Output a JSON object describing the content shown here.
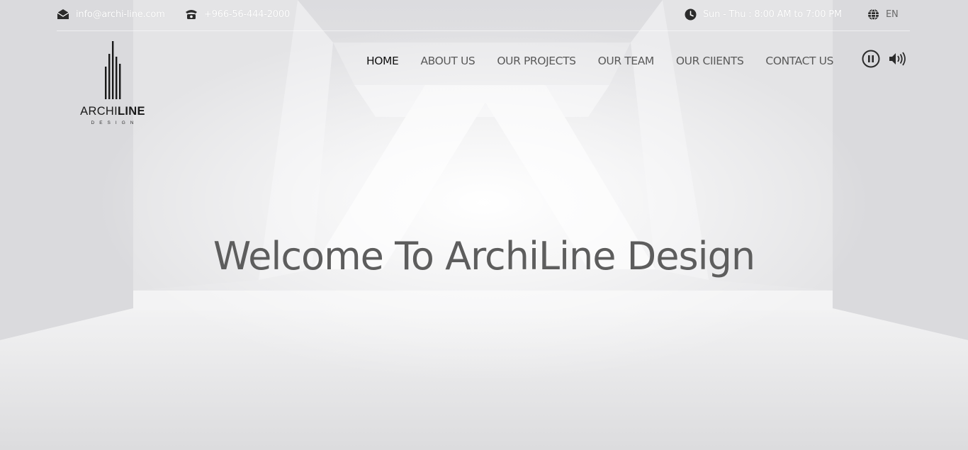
{
  "topbar": {
    "email": "info@archi-line.com",
    "phone": "+966-56-444-2000",
    "hours": "Sun - Thu : 8:00 AM to 7:00 PM",
    "language": "EN"
  },
  "logo": {
    "word_light": "ARCHI",
    "word_bold": "LINE",
    "subtitle": "DESIGN"
  },
  "nav": {
    "items": [
      {
        "label": "HOME",
        "active": true
      },
      {
        "label": "ABOUT US"
      },
      {
        "label": "OUR PROJECTS"
      },
      {
        "label": "OUR TEAM"
      },
      {
        "label": "OUR CIIENTS"
      },
      {
        "label": "CONTACT US"
      }
    ]
  },
  "media": {
    "pause_icon": "pause-circle-icon",
    "volume_icon": "volume-icon"
  },
  "hero": {
    "headline": "Welcome To ArchiLine Design"
  },
  "icons": {
    "email": "envelope-icon",
    "phone": "telephone-icon",
    "hours": "clock-icon",
    "language": "globe-icon"
  },
  "colors": {
    "nav_text": "#5a5a5a",
    "nav_active": "#111111",
    "topbar_text": "#ffffff",
    "hero_text": "#5d5d5d"
  }
}
